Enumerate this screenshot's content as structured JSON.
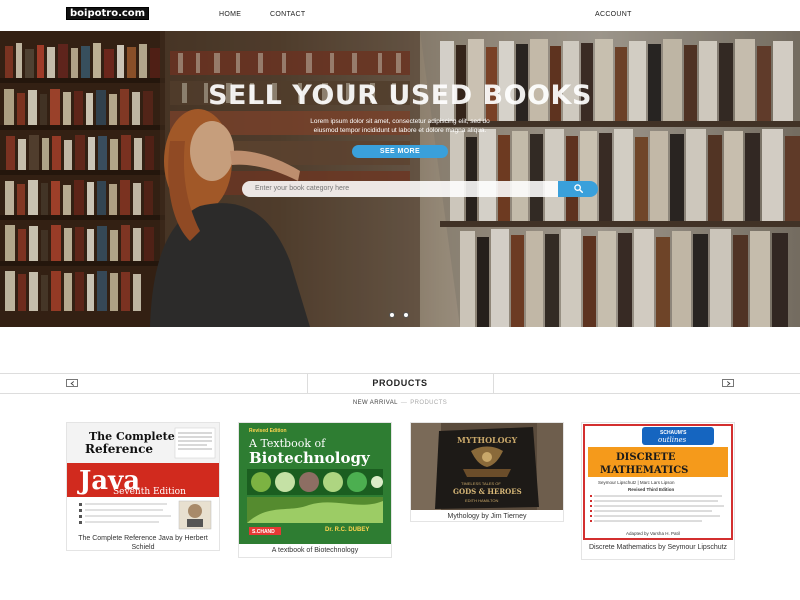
{
  "nav": {
    "logo": "boipotro.com",
    "home": "HOME",
    "contact": "CONTACT",
    "account": "ACCOUNT"
  },
  "hero": {
    "title": "SELL YOUR USED BOOKS",
    "text": "Lorem ipsum dolor sit amet, consectetur adipiscing elit, sed do eiusmod tempor incididunt ut labore et dolore magna aliqua.",
    "button": "SEE MORE",
    "search_placeholder": "Enter your book category here",
    "slides": 2
  },
  "products": {
    "title": "PRODUCTS",
    "tab_new": "NEW ARRIVAL",
    "tab_sep": "—",
    "tab_products": "PRODUCTS"
  },
  "books": [
    {
      "caption": "The Complete Reference Java by Herbert Schield",
      "cover_title_1": "The Complete",
      "cover_title_2": "Reference",
      "cover_main": "Java",
      "cover_edition": "Seventh Edition"
    },
    {
      "caption": "A textbook of Biotechnology",
      "cover_tag": "Revised Edition",
      "cover_title_1": "A Textbook of",
      "cover_title_2": "Biotechnology",
      "cover_author": "Dr. R.C. DUBEY",
      "cover_publisher": "S.CHAND"
    },
    {
      "caption": "Mythology by Jim Tierney",
      "cover_title": "MYTHOLOGY",
      "cover_subtitle": "TIMELESS TALES OF",
      "cover_main": "GODS & HEROES",
      "cover_author": "EDITH HAMILTON"
    },
    {
      "caption": "Discrete Mathematics by Seymour Lipschutz",
      "cover_series": "SCHAUM'S",
      "cover_series_2": "outlines",
      "cover_title_1": "DISCRETE",
      "cover_title_2": "MATHEMATICS",
      "cover_authors": "Seymour Lipschutz | Marc Lars Lipson",
      "cover_edition": "Revised Third Edition",
      "cover_adapted": "Adapted by Varsha H. Patil"
    }
  ],
  "colors": {
    "accent": "#3aa0db",
    "java_red": "#d12a1e",
    "bio_green": "#2e7d32",
    "schaum_orange": "#f59a1b"
  }
}
